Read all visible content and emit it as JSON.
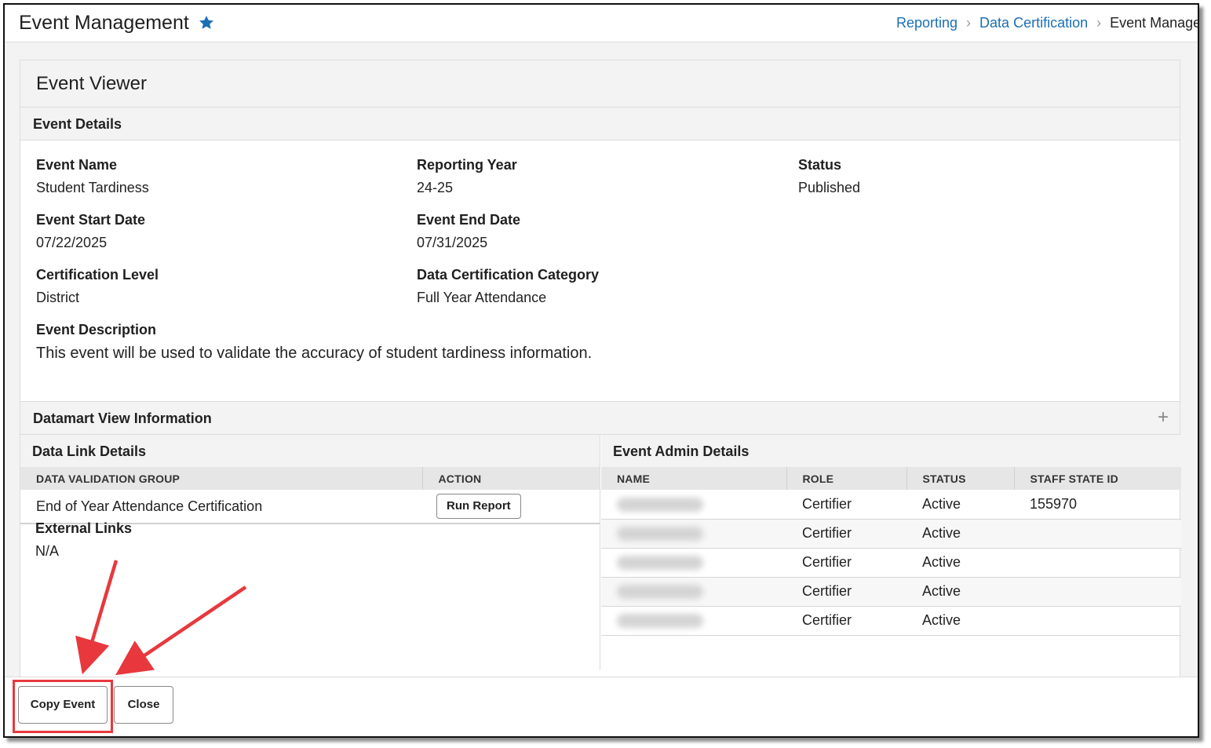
{
  "header": {
    "title": "Event Management",
    "breadcrumb": [
      "Reporting",
      "Data Certification",
      "Event Managen"
    ]
  },
  "viewer": {
    "title": "Event Viewer",
    "event_details": {
      "heading": "Event Details",
      "fields": [
        {
          "label": "Event Name",
          "value": "Student Tardiness"
        },
        {
          "label": "Reporting Year",
          "value": "24-25"
        },
        {
          "label": "Status",
          "value": "Published"
        },
        {
          "label": "Event Start Date",
          "value": "07/22/2025"
        },
        {
          "label": "Event End Date",
          "value": "07/31/2025"
        },
        {
          "label": "Certification Level",
          "value": "District"
        },
        {
          "label": "Data Certification Category",
          "value": "Full Year Attendance"
        },
        {
          "label": "Event Description",
          "value": "This event will be used to validate the accuracy of student tardiness information."
        }
      ]
    },
    "datamart": {
      "heading": "Datamart View Information",
      "expand_icon": "plus-icon"
    },
    "data_link": {
      "heading": "Data Link Details",
      "columns": [
        "DATA VALIDATION GROUP",
        "ACTION"
      ],
      "rows": [
        {
          "group": "End of Year Attendance Certification",
          "action": "Run Report"
        }
      ],
      "external_links": {
        "label": "External Links",
        "value": "N/A"
      }
    },
    "event_admin": {
      "heading": "Event Admin Details",
      "columns": [
        "NAME",
        "ROLE",
        "STATUS",
        "STAFF STATE ID"
      ],
      "rows": [
        {
          "role": "Certifier",
          "status": "Active",
          "staff_id": "155970"
        },
        {
          "role": "Certifier",
          "status": "Active",
          "staff_id": ""
        },
        {
          "role": "Certifier",
          "status": "Active",
          "staff_id": ""
        },
        {
          "role": "Certifier",
          "status": "Active",
          "staff_id": ""
        },
        {
          "role": "Certifier",
          "status": "Active",
          "staff_id": ""
        }
      ]
    }
  },
  "footer": {
    "copy_label": "Copy Event",
    "close_label": "Close"
  },
  "colors": {
    "link": "#1a6fb5",
    "annotation": "#e8383d",
    "star": "#1a6fb5"
  }
}
